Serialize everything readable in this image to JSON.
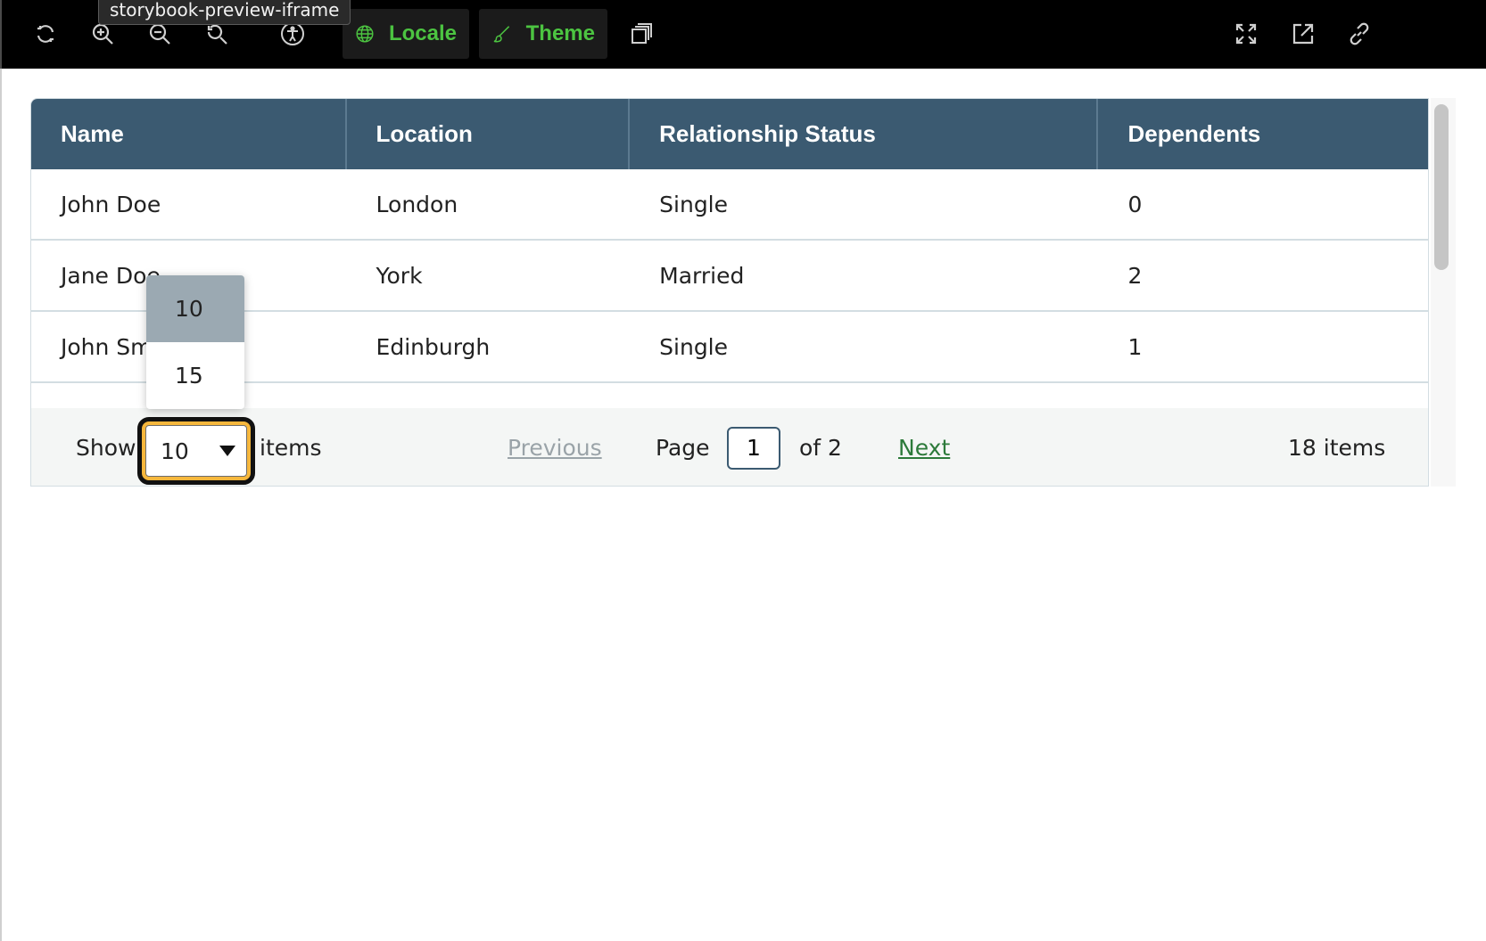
{
  "toolbar": {
    "tooltip": "storybook-preview-iframe",
    "locale_label": "Locale",
    "theme_label": "Theme",
    "accent_color": "#4cc441",
    "icons": [
      "reload-icon",
      "zoom-in-icon",
      "zoom-out-icon",
      "zoom-reset-icon",
      "accessibility-icon",
      "globe-icon",
      "brush-icon",
      "outline-icon",
      "fullscreen-icon",
      "open-new-tab-icon",
      "copy-link-icon"
    ]
  },
  "table": {
    "header_color": "#3b5a71",
    "columns": [
      "Name",
      "Location",
      "Relationship Status",
      "Dependents"
    ],
    "rows": [
      {
        "name": "John Doe",
        "location": "London",
        "status": "Single",
        "dependents": "0"
      },
      {
        "name": "Jane Doe",
        "location": "York",
        "status": "Married",
        "dependents": "2"
      },
      {
        "name": "John Smith",
        "location": "Edinburgh",
        "status": "Single",
        "dependents": "1"
      }
    ]
  },
  "pagination": {
    "show_label": "Show",
    "page_size": "10",
    "items_label": "items",
    "previous_label": "Previous",
    "page_label": "Page",
    "current_page": "1",
    "of_label": "of 2",
    "next_label": "Next",
    "total_label": "18 items",
    "focus_color": "#f6b73c"
  },
  "page_size_options": [
    "10",
    "15"
  ]
}
